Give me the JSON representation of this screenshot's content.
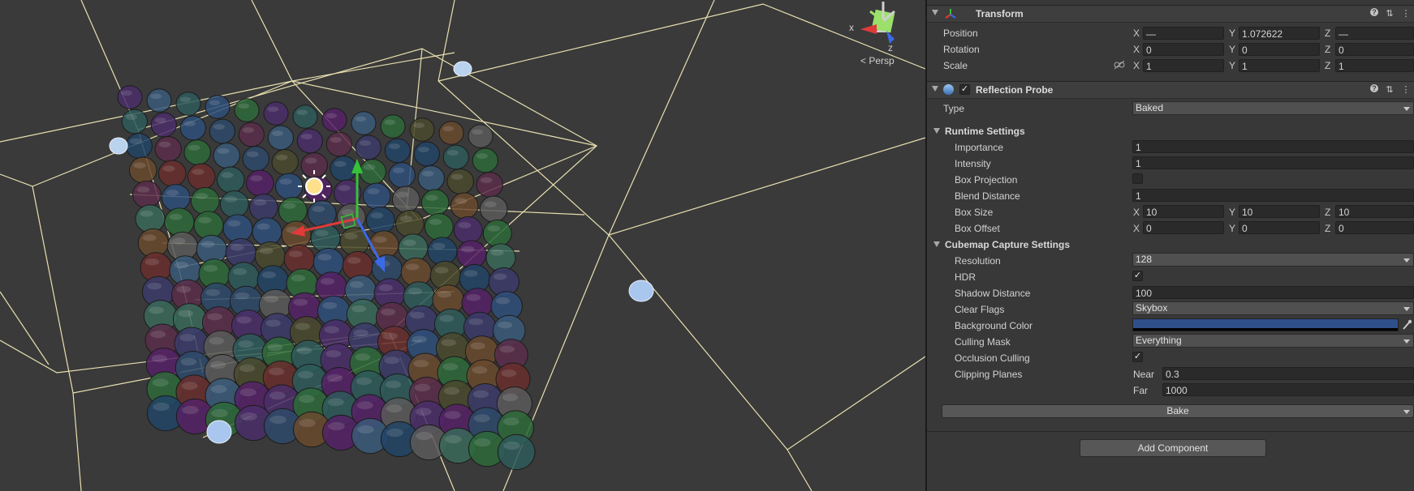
{
  "scene": {
    "view_label": "Persp",
    "axis_x": "x",
    "axis_z": "z",
    "accent_colors": {
      "x_axis": "#e03a3a",
      "y_axis": "#36c236",
      "z_axis": "#3b6ae8",
      "bounds": "#e8e0b0"
    }
  },
  "transform": {
    "title": "Transform",
    "position_label": "Position",
    "rotation_label": "Rotation",
    "scale_label": "Scale",
    "axis_x": "X",
    "axis_y": "Y",
    "axis_z": "Z",
    "position": {
      "x": "—",
      "y": "1.072622",
      "z": "—"
    },
    "rotation": {
      "x": "0",
      "y": "0",
      "z": "0"
    },
    "scale": {
      "x": "1",
      "y": "1",
      "z": "1"
    }
  },
  "probe": {
    "title": "Reflection Probe",
    "enabled_check": "✓",
    "type_label": "Type",
    "type_value": "Baked",
    "runtime": {
      "title": "Runtime Settings",
      "importance_label": "Importance",
      "importance": "1",
      "intensity_label": "Intensity",
      "intensity": "1",
      "box_projection_label": "Box Projection",
      "blend_distance_label": "Blend Distance",
      "blend_distance": "1",
      "box_size_label": "Box Size",
      "box_size": {
        "x": "10",
        "y": "10",
        "z": "10"
      },
      "box_offset_label": "Box Offset",
      "box_offset": {
        "x": "0",
        "y": "0",
        "z": "0"
      }
    },
    "cubemap": {
      "title": "Cubemap Capture Settings",
      "resolution_label": "Resolution",
      "resolution": "128",
      "hdr_label": "HDR",
      "hdr_check": "✓",
      "shadow_distance_label": "Shadow Distance",
      "shadow_distance": "100",
      "clear_flags_label": "Clear Flags",
      "clear_flags": "Skybox",
      "background_color_label": "Background Color",
      "background_color": "#2f4f8a",
      "culling_mask_label": "Culling Mask",
      "culling_mask": "Everything",
      "occlusion_culling_label": "Occlusion Culling",
      "occlusion_check": "✓",
      "clipping_planes_label": "Clipping Planes",
      "near_label": "Near",
      "near": "0.3",
      "far_label": "Far",
      "far": "1000"
    },
    "bake_label": "Bake"
  },
  "add_component_label": "Add Component",
  "header_icons": {
    "help": "?",
    "presets": "⇅",
    "more": "⋮"
  }
}
